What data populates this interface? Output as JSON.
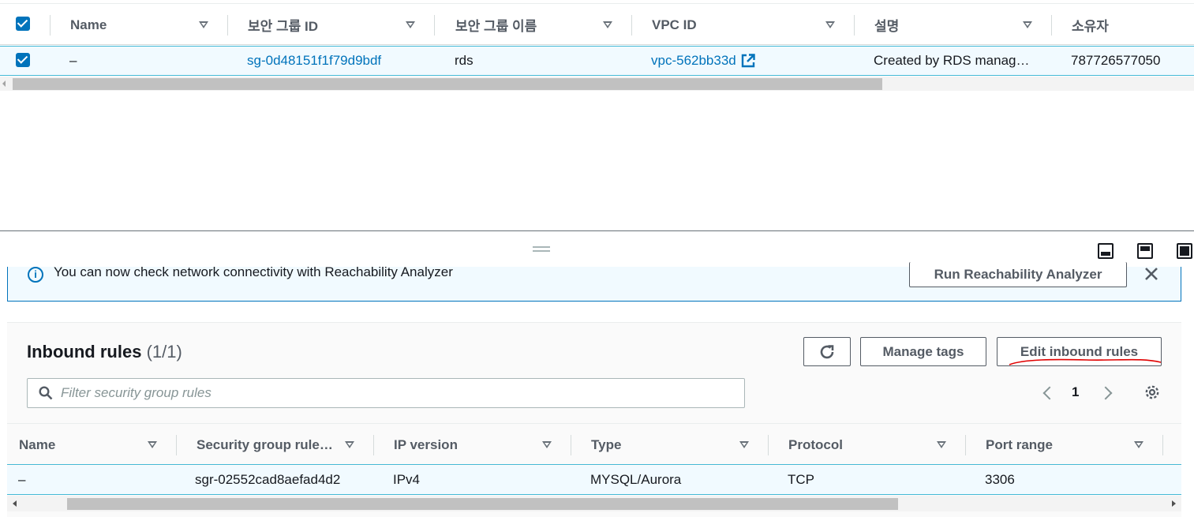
{
  "security_groups_table": {
    "columns": [
      "Name",
      "보안 그룹 ID",
      "보안 그룹 이름",
      "VPC ID",
      "설명",
      "소유자"
    ],
    "rows": [
      {
        "name": "–",
        "sg_id": "sg-0d48151f1f79d9bdf",
        "sg_name": "rds",
        "vpc_id": "vpc-562bb33d",
        "description": "Created by RDS manag…",
        "owner": "787726577050"
      }
    ]
  },
  "banner": {
    "text": "You can now check network connectivity with Reachability Analyzer",
    "button_label": "Run Reachability Analyzer"
  },
  "inbound": {
    "title": "Inbound rules",
    "count": "(1/1)",
    "manage_tags_label": "Manage tags",
    "edit_label": "Edit inbound rules",
    "search_placeholder": "Filter security group rules",
    "page_number": "1",
    "columns": [
      "Name",
      "Security group rule…",
      "IP version",
      "Type",
      "Protocol",
      "Port range"
    ],
    "rows": [
      {
        "name": "–",
        "rule_id": "sgr-02552cad8aefad4d2",
        "ip_version": "IPv4",
        "type": "MYSQL/Aurora",
        "protocol": "TCP",
        "port_range": "3306"
      }
    ]
  },
  "colors": {
    "link": "#0073bb",
    "selected_row_bg": "#f1faff",
    "selected_border": "#44b9d6",
    "annotation": "#e00000"
  }
}
